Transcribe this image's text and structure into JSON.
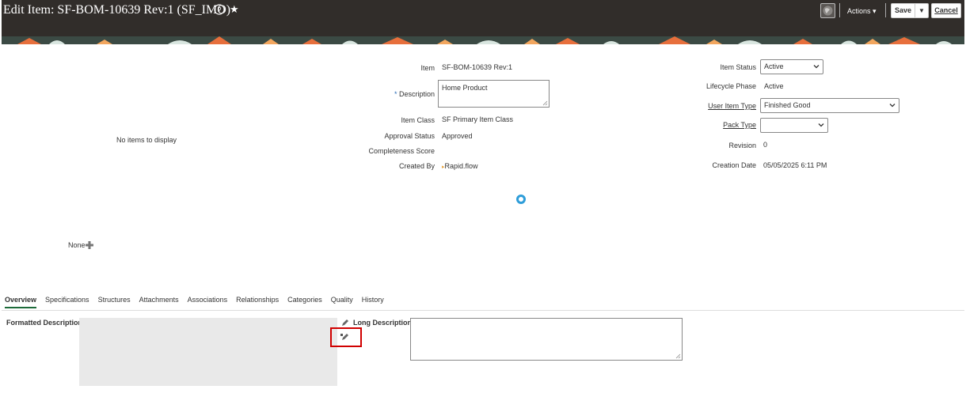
{
  "header": {
    "title": "Edit Item: SF-BOM-10639 Rev:1 (SF_IMO)",
    "actions_label": "Actions",
    "save_label": "Save",
    "cancel_label": "Cancel",
    "icons": [
      "help-icon",
      "star-icon",
      "globe-icon",
      "caret-down-icon"
    ]
  },
  "left_panel": {
    "empty_message": "No items to display",
    "none_label": "None"
  },
  "item_fields": {
    "item_label": "Item",
    "item_value": "SF-BOM-10639 Rev:1",
    "description_required": "*",
    "description_label": "Description",
    "description_value": "Home Product",
    "item_class_label": "Item Class",
    "item_class_value": "SF Primary Item Class",
    "approval_status_label": "Approval Status",
    "approval_status_value": "Approved",
    "completeness_label": "Completeness Score",
    "created_by_label": "Created By",
    "created_by_value": "Rapid.flow"
  },
  "status_fields": {
    "item_status_label": "Item Status",
    "item_status_value": "Active",
    "lifecycle_label": "Lifecycle Phase",
    "lifecycle_value": "Active",
    "user_item_type_label": "User Item Type",
    "user_item_type_value": "Finished Good",
    "pack_type_label": "Pack Type",
    "pack_type_value": "",
    "revision_label": "Revision",
    "revision_value": "0",
    "creation_date_label": "Creation Date",
    "creation_date_value": "05/05/2025 6:11 PM"
  },
  "tabs": [
    "Overview",
    "Specifications",
    "Structures",
    "Attachments",
    "Associations",
    "Relationships",
    "Categories",
    "Quality",
    "History"
  ],
  "active_tab": "Overview",
  "overview": {
    "formatted_description_label": "Formatted Description",
    "long_description_label": "Long Description",
    "long_description_value": ""
  },
  "colors": {
    "header_bg": "#312d2a",
    "spinner": "#2e9dd9",
    "highlight_box": "#d00000",
    "active_tab_underline": "#1d6b3a",
    "required_marker": "#2a6bb6"
  }
}
